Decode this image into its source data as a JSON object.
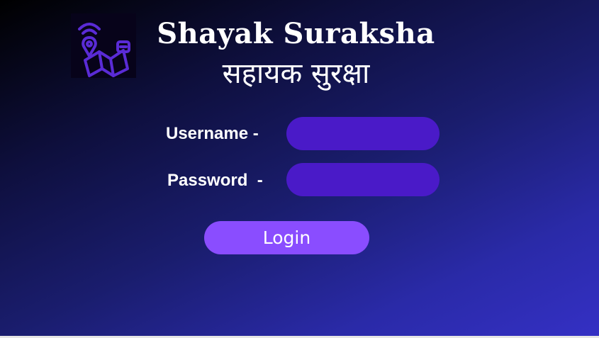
{
  "header": {
    "title": "Shayak Suraksha",
    "subtitle": "सहायक सुरक्षा",
    "logo_icon": "map-location-wifi-icon"
  },
  "form": {
    "username_label": "Username -",
    "password_label": "Password  -",
    "username_value": "",
    "password_value": "",
    "login_label": "Login"
  },
  "colors": {
    "input_fill": "#4a1ac8",
    "button_fill": "#8a4dff",
    "logo_accent": "#5a2bd6",
    "text": "#ffffff"
  }
}
